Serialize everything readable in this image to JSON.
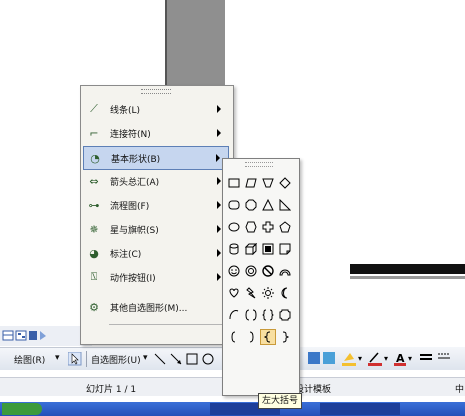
{
  "shape_menu": {
    "items": [
      {
        "label": "线条(L)",
        "icon": "lines-icon"
      },
      {
        "label": "连接符(N)",
        "icon": "connector-icon"
      },
      {
        "label": "基本形状(B)",
        "icon": "basic-shapes-icon",
        "selected": true
      },
      {
        "label": "箭头总汇(A)",
        "icon": "block-arrows-icon"
      },
      {
        "label": "流程图(F)",
        "icon": "flowchart-icon"
      },
      {
        "label": "星与旗帜(S)",
        "icon": "stars-banners-icon"
      },
      {
        "label": "标注(C)",
        "icon": "callouts-icon"
      },
      {
        "label": "动作按钮(I)",
        "icon": "action-buttons-icon"
      },
      {
        "label": "其他自选图形(M)...",
        "icon": "more-autoshapes-icon"
      }
    ]
  },
  "tooltip": "左大括号",
  "drawing_toolbar": {
    "draw_label": "绘图(R)",
    "autoshapes_label": "自选图形(U)"
  },
  "status_bar": {
    "slide_indicator": "幻灯片 1 / 1",
    "template_label": "设计模板",
    "lang_partial": "中"
  },
  "colors": {
    "menu_bg": "#f4f3ee",
    "selected_bg": "#c6d6ef",
    "tooltip_bg": "#ffffe1",
    "taskbar": "#2450b8"
  }
}
